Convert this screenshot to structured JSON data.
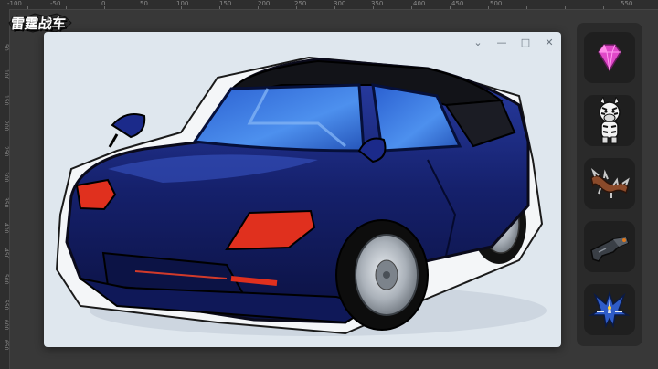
{
  "app": {
    "title": "雷霆战车"
  },
  "ruler": {
    "top_labels": [
      "-100",
      "-50",
      "0",
      "50",
      "100",
      "150",
      "200",
      "250",
      "300",
      "350",
      "400",
      "450",
      "500",
      "550"
    ],
    "left_labels": [
      "50",
      "100",
      "150",
      "200",
      "250",
      "300",
      "350",
      "400",
      "450",
      "500",
      "550",
      "600",
      "650"
    ]
  },
  "window": {
    "controls": {
      "menu": "⌄",
      "minimize": "—",
      "maximize": "□",
      "close": "✕"
    }
  },
  "colors": {
    "car_body": "#15206b",
    "car_highlight": "#3b57c9",
    "glass": "#3c7be0",
    "roof": "#121318",
    "lights": "#e0301e",
    "wheel_rim": "#b9bfc6"
  },
  "panel": {
    "slots": [
      {
        "name": "gem",
        "icon": "pink-gem-icon"
      },
      {
        "name": "zebra-mascot",
        "icon": "zebra-mascot-icon"
      },
      {
        "name": "spiked-chain",
        "icon": "spiked-chain-icon"
      },
      {
        "name": "blaster",
        "icon": "blaster-gun-icon"
      },
      {
        "name": "mecha-jet",
        "icon": "mecha-jet-icon"
      }
    ]
  }
}
